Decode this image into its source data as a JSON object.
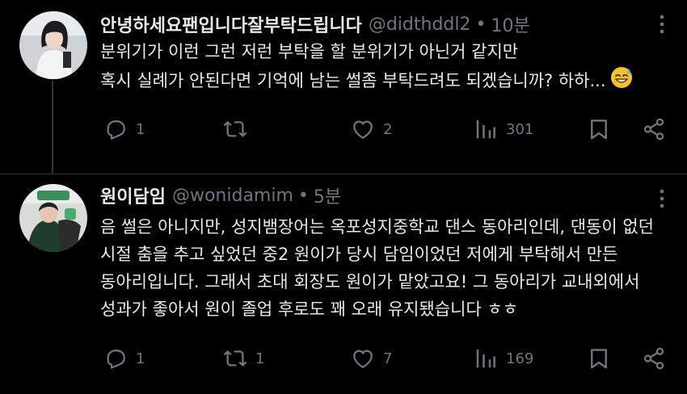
{
  "posts": [
    {
      "display_name": "안녕하세요팬입니다잘부탁드립니다",
      "handle": "@didthddl2",
      "separator": "•",
      "time": "10분",
      "lines": [
        "분위기가 이런 그런 저런 부탁을 할 분위기가 아닌거 같지만",
        "혹시 실례가 안된다면 기억에 남는 썰좀 부탁드려도 되겠습니까? 하하..."
      ],
      "emoji": "smiling-face-with-sweat-icon",
      "replies": "1",
      "reposts": "",
      "likes": "2",
      "views": "301"
    },
    {
      "display_name": "원이담임",
      "handle": "@wonidamim",
      "separator": "•",
      "time": "5분",
      "lines": [
        "음 썰은 아니지만, 성지뱀장어는 옥포성지중학교 댄스 동아리인데, 댄동이 없던",
        "시절 춤을 추고 싶었던 중2 원이가 당시 담임이었던 저에게 부탁해서 만든",
        "동아리입니다. 그래서 초대 회장도 원이가 맡았고요! 그 동아리가 교내외에서",
        "성과가 좋아서 원이 졸업 후로도 꽤 오래 유지됐습니다 ㅎㅎ"
      ],
      "replies": "1",
      "reposts": "1",
      "likes": "7",
      "views": "169"
    }
  ],
  "colors": {
    "background": "#000000",
    "text": "#e7e9ea",
    "muted": "#71767b",
    "divider": "#2f3336"
  }
}
